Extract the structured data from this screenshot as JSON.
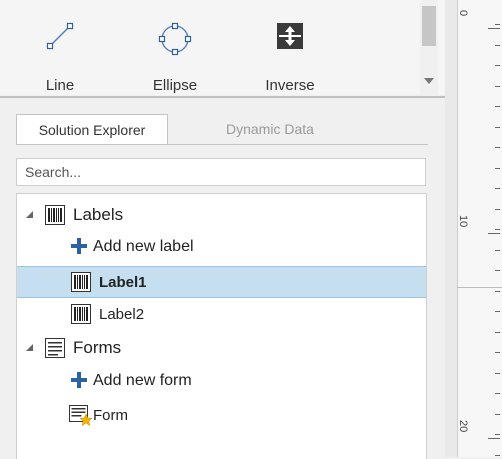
{
  "toolbar": {
    "tools": [
      {
        "label": "Line",
        "icon": "line-tool-icon"
      },
      {
        "label": "Ellipse",
        "icon": "ellipse-tool-icon"
      },
      {
        "label": "Inverse",
        "icon": "inverse-tool-icon"
      }
    ]
  },
  "ruler": {
    "numbers": [
      "0",
      "10",
      "20"
    ]
  },
  "explorer": {
    "tabs": [
      {
        "label": "Solution Explorer",
        "active": true
      },
      {
        "label": "Dynamic Data",
        "active": false
      }
    ],
    "search_placeholder": "Search...",
    "tree": {
      "labels_group": "Labels",
      "add_label": "Add new label",
      "label_items": [
        "Label1",
        "Label2"
      ],
      "selected": "Label1",
      "forms_group": "Forms",
      "add_form": "Add new form",
      "form_items": [
        "Form"
      ]
    }
  },
  "colors": {
    "selection": "#c5dff0",
    "plus": "#2c62a3",
    "star": "#f2b400"
  }
}
